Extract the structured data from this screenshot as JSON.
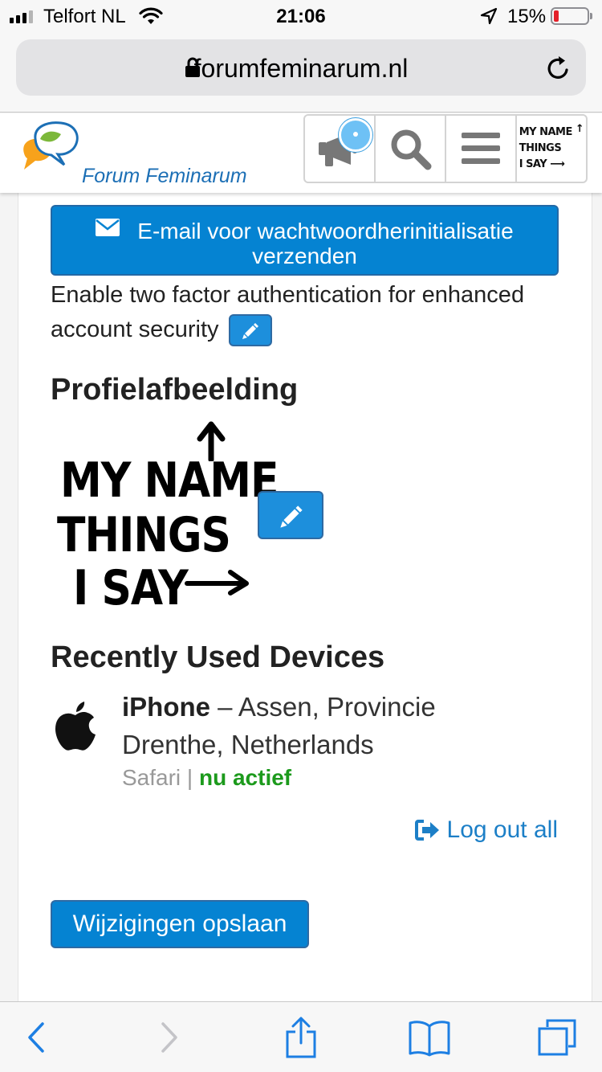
{
  "status_bar": {
    "carrier": "Telfort NL",
    "time": "21:06",
    "battery_percent": "15%",
    "battery_level": 0.15
  },
  "browser": {
    "url": "forumfeminarum.nl"
  },
  "site": {
    "logo_text": "Forum Feminarum",
    "nav_icons": [
      "megaphone-icon",
      "search-icon",
      "menu-icon",
      "user-avatar"
    ]
  },
  "avatar_text": [
    "MY NAME",
    "THINGS",
    "I SAY"
  ],
  "account": {
    "reset_email_button": "E-mail voor wachtwoordherinitialisatie verzenden",
    "two_factor_text": "Enable two factor authentication for enhanced account security",
    "profile_heading": "Profielafbeelding",
    "devices_heading": "Recently Used Devices",
    "device": {
      "name": "iPhone",
      "separator": " – ",
      "location": "Assen, Provincie Drenthe, Netherlands",
      "browser": "Safari",
      "divider": " | ",
      "status": "nu actief"
    },
    "logout_all": "Log out all",
    "save_button": "Wijzigingen opslaan"
  },
  "colors": {
    "primary_button": "#0583d2",
    "link": "#1c7fc7",
    "active_status": "#1c9a1c",
    "logo_text": "#1c6fb5"
  }
}
